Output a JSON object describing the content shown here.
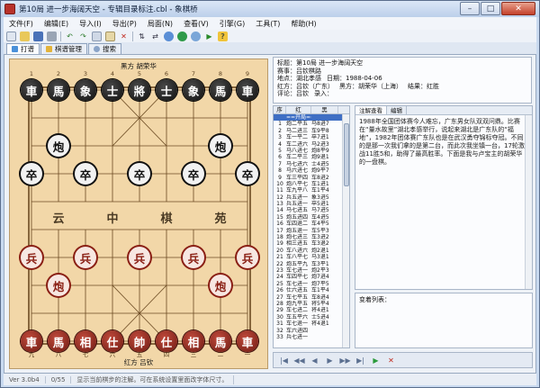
{
  "window": {
    "title": "第10局 进一步海阔天空 - 专辑目录标注.cbl - 象棋桥",
    "buttons": {
      "minimize": "–",
      "maximize": "□",
      "close": "✕"
    }
  },
  "menu": [
    "文件(F)",
    "编辑(E)",
    "导入(I)",
    "导出(P)",
    "局面(N)",
    "查看(V)",
    "引擎(G)",
    "工具(T)",
    "帮助(H)"
  ],
  "toolbar": {
    "icons": [
      "new-icon",
      "open-icon",
      "save-icon",
      "print-icon",
      "undo-icon",
      "redo-icon",
      "copy-icon",
      "paste-icon",
      "delete-icon",
      "flip-icon",
      "swap-icon",
      "analyze-icon",
      "engine-icon",
      "record-icon",
      "play-icon",
      "help-icon"
    ]
  },
  "tabs": [
    {
      "label": "打谱",
      "active": true
    },
    {
      "label": "棋谱管理",
      "active": false
    },
    {
      "label": "搜索",
      "active": false
    }
  ],
  "board": {
    "top_player": "黑方 胡荣华",
    "bottom_player": "红方 吕钦",
    "files_top": [
      "1",
      "2",
      "3",
      "4",
      "5",
      "6",
      "7",
      "8",
      "9"
    ],
    "files_bottom": [
      "九",
      "八",
      "七",
      "六",
      "五",
      "四",
      "三",
      "二",
      "一"
    ],
    "river": [
      "云",
      "中",
      "棋",
      "苑"
    ],
    "pieces": [
      {
        "side": "black",
        "label": "車",
        "file": 0,
        "rank": 0
      },
      {
        "side": "black",
        "label": "馬",
        "file": 1,
        "rank": 0
      },
      {
        "side": "black",
        "label": "象",
        "file": 2,
        "rank": 0
      },
      {
        "side": "black",
        "label": "士",
        "file": 3,
        "rank": 0
      },
      {
        "side": "black",
        "label": "將",
        "file": 4,
        "rank": 0
      },
      {
        "side": "black",
        "label": "士",
        "file": 5,
        "rank": 0
      },
      {
        "side": "black",
        "label": "象",
        "file": 6,
        "rank": 0
      },
      {
        "side": "black",
        "label": "馬",
        "file": 7,
        "rank": 0
      },
      {
        "side": "black",
        "label": "車",
        "file": 8,
        "rank": 0
      },
      {
        "side": "black",
        "label": "炮",
        "file": 1,
        "rank": 2
      },
      {
        "side": "black",
        "label": "炮",
        "file": 7,
        "rank": 2
      },
      {
        "side": "black",
        "label": "卒",
        "file": 0,
        "rank": 3
      },
      {
        "side": "black",
        "label": "卒",
        "file": 2,
        "rank": 3
      },
      {
        "side": "black",
        "label": "卒",
        "file": 4,
        "rank": 3
      },
      {
        "side": "black",
        "label": "卒",
        "file": 6,
        "rank": 3
      },
      {
        "side": "black",
        "label": "卒",
        "file": 8,
        "rank": 3
      },
      {
        "side": "red",
        "label": "兵",
        "file": 0,
        "rank": 6
      },
      {
        "side": "red",
        "label": "兵",
        "file": 2,
        "rank": 6
      },
      {
        "side": "red",
        "label": "兵",
        "file": 4,
        "rank": 6
      },
      {
        "side": "red",
        "label": "兵",
        "file": 6,
        "rank": 6
      },
      {
        "side": "red",
        "label": "兵",
        "file": 8,
        "rank": 6
      },
      {
        "side": "red",
        "label": "炮",
        "file": 1,
        "rank": 7
      },
      {
        "side": "red",
        "label": "炮",
        "file": 7,
        "rank": 7
      },
      {
        "side": "red",
        "label": "車",
        "file": 0,
        "rank": 9
      },
      {
        "side": "red",
        "label": "馬",
        "file": 1,
        "rank": 9
      },
      {
        "side": "red",
        "label": "相",
        "file": 2,
        "rank": 9
      },
      {
        "side": "red",
        "label": "仕",
        "file": 3,
        "rank": 9
      },
      {
        "side": "red",
        "label": "帥",
        "file": 4,
        "rank": 9
      },
      {
        "side": "red",
        "label": "仕",
        "file": 5,
        "rank": 9
      },
      {
        "side": "red",
        "label": "相",
        "file": 6,
        "rank": 9
      },
      {
        "side": "red",
        "label": "馬",
        "file": 7,
        "rank": 9
      },
      {
        "side": "red",
        "label": "車",
        "file": 8,
        "rank": 9
      }
    ]
  },
  "game_info": {
    "title": "标题：第10局 进一步海阔天空",
    "event": "赛事：吕钦棋路",
    "place": "地点：湖北孝感",
    "date": "日期：1988-04-06",
    "red": "红方：吕钦（广东）",
    "black": "黑方：胡荣华（上海）",
    "result": "结果：红胜",
    "annotator": "评论：吕钦",
    "recorder": "录入："
  },
  "movelist": {
    "headers": [
      "序",
      "红",
      "黑"
    ],
    "rows": [
      {
        "no": "",
        "red": "==开局==",
        "black": "",
        "selected": true
      },
      {
        "no": "1",
        "red": "炮二平五",
        "black": "马8进7"
      },
      {
        "no": "2",
        "red": "马二进三",
        "black": "车9平8"
      },
      {
        "no": "3",
        "red": "车一平二",
        "black": "卒7进1"
      },
      {
        "no": "4",
        "red": "车二进六",
        "black": "马2进3"
      },
      {
        "no": "5",
        "red": "马八进七",
        "black": "炮8平9"
      },
      {
        "no": "6",
        "red": "车二平三",
        "black": "炮9退1"
      },
      {
        "no": "7",
        "red": "马七进六",
        "black": "士4进5"
      },
      {
        "no": "8",
        "red": "马六进七",
        "black": "炮9平7"
      },
      {
        "no": "9",
        "red": "车三平四",
        "black": "车8进2"
      },
      {
        "no": "10",
        "red": "炮八平七",
        "black": "车1进1"
      },
      {
        "no": "11",
        "red": "车九平八",
        "black": "车1平4"
      },
      {
        "no": "12",
        "red": "兵五进一",
        "black": "象3进5"
      },
      {
        "no": "13",
        "red": "兵五进一",
        "black": "卒5进1"
      },
      {
        "no": "14",
        "red": "马七进五",
        "black": "马7进5"
      },
      {
        "no": "15",
        "red": "炮五进四",
        "black": "车4进5"
      },
      {
        "no": "16",
        "red": "车四退二",
        "black": "车4平5"
      },
      {
        "no": "17",
        "red": "炮五退一",
        "black": "车5平3"
      },
      {
        "no": "18",
        "red": "炮七进三",
        "black": "车3进2"
      },
      {
        "no": "19",
        "red": "相三进五",
        "black": "车3退2"
      },
      {
        "no": "20",
        "red": "车八进六",
        "black": "炮2退1"
      },
      {
        "no": "21",
        "red": "车八平七",
        "black": "马3退1"
      },
      {
        "no": "22",
        "red": "炮五平九",
        "black": "车3平1"
      },
      {
        "no": "23",
        "red": "车七进一",
        "black": "炮2平3"
      },
      {
        "no": "24",
        "red": "车四平七",
        "black": "炮7进4"
      },
      {
        "no": "25",
        "red": "车七进一",
        "black": "炮7平5"
      },
      {
        "no": "26",
        "red": "仕六进五",
        "black": "车1平4"
      },
      {
        "no": "27",
        "red": "车七平五",
        "black": "车8进4"
      },
      {
        "no": "28",
        "red": "炮九平五",
        "black": "将5平4"
      },
      {
        "no": "29",
        "red": "车七进二",
        "black": "将4进1"
      },
      {
        "no": "30",
        "red": "车五平六",
        "black": "士5进4"
      },
      {
        "no": "31",
        "red": "车七退一",
        "black": "将4退1"
      },
      {
        "no": "32",
        "red": "车六进四",
        "black": ""
      },
      {
        "no": "33",
        "red": "兵七进一",
        "black": ""
      }
    ]
  },
  "notes": {
    "tabs": [
      "注解查看",
      "编辑"
    ],
    "text": "1988年全国团体赛今人难忘，广东男女队双双问鼎。比赛在“量水故里”湖北孝感举行，说起来湖北是广东队的“福地”，1982年团体赛广东队也是在武汉勇夺锦标夺冠。不同的是那一次我们拿的是第二台，而此次我坐镇一台，17轮激战11胜5和，助得了最高胜率。下面是我与卢宝主的胡荣华的一盘棋。"
  },
  "variations": {
    "label": "变着列表："
  },
  "navbar": {
    "icons": [
      "first-icon",
      "prev-icon",
      "prev-step-icon",
      "next-step-icon",
      "next-icon",
      "last-icon",
      "play-icon",
      "stop-icon"
    ]
  },
  "status": [
    "Ver 3.0b4",
    "0/55",
    "显示当前棋步的注解。可在系统设置里面改字体尺寸。"
  ],
  "colors": {
    "red_piece": "#7a1d14",
    "black_piece": "#111111",
    "board": "#f2d7a8",
    "selection": "#3f6fc4"
  }
}
